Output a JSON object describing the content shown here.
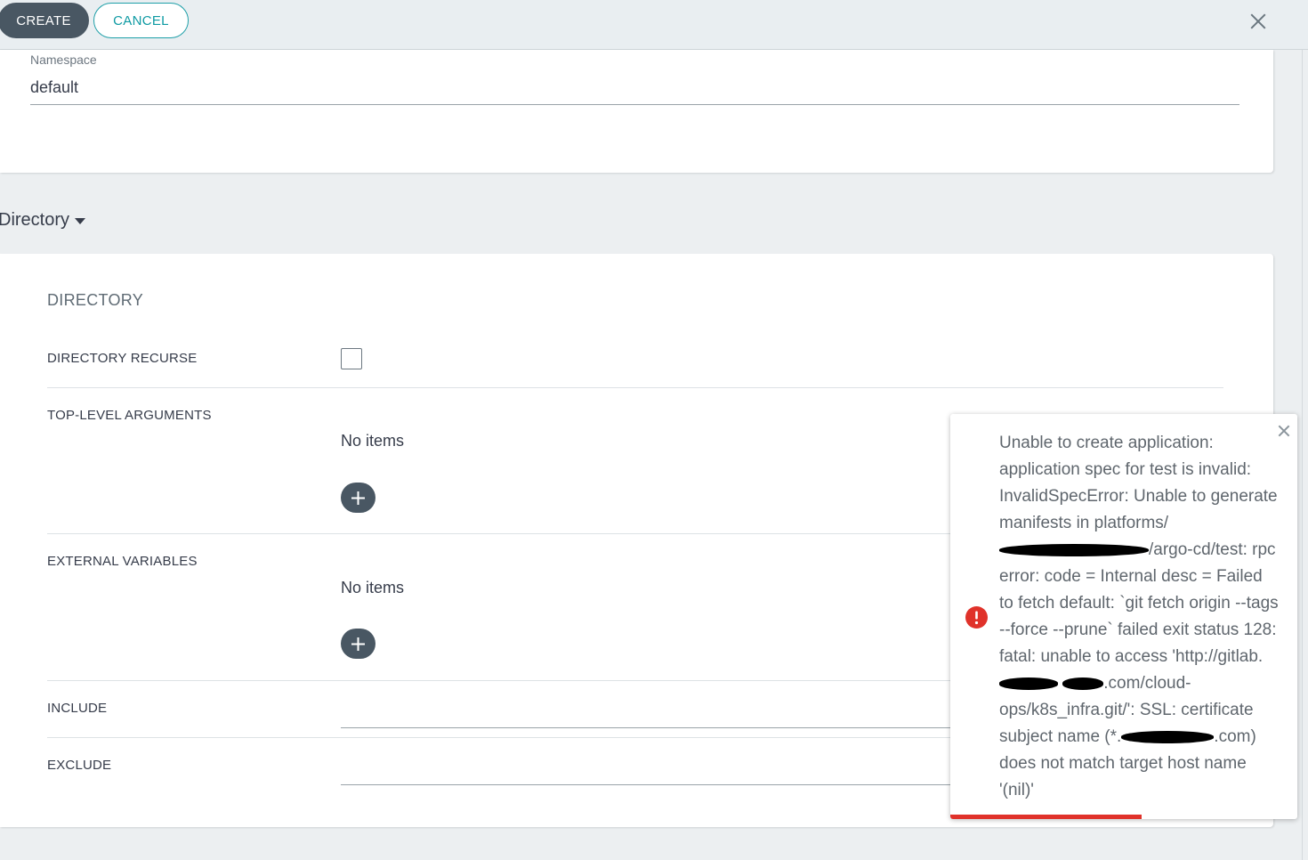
{
  "toolbar": {
    "create_label": "CREATE",
    "cancel_label": "CANCEL"
  },
  "namespace": {
    "label": "Namespace",
    "value": "default"
  },
  "section_toggle": {
    "label": "Directory"
  },
  "directory": {
    "title": "DIRECTORY",
    "recurse_label": "DIRECTORY RECURSE",
    "recurse_checked": false,
    "top_level_args": {
      "label": "TOP-LEVEL ARGUMENTS",
      "empty_text": "No items"
    },
    "external_vars": {
      "label": "EXTERNAL VARIABLES",
      "empty_text": "No items"
    },
    "include_label": "INCLUDE",
    "exclude_label": "EXCLUDE"
  },
  "toast": {
    "type": "error",
    "icon": "error-icon",
    "message_p1": "Unable to create application: application spec for test is invalid: InvalidSpecError: Unable to generate manifests in platforms/",
    "message_p2": "/argo-cd/test: rpc error: code = Internal desc = Failed to fetch default: `git fetch origin --tags --force --prune` failed exit status 128: fatal: unable to access 'http://gitlab.",
    "message_p3": ".com/cloud-ops/k8s_infra.git/': SSL: certificate subject name (*.",
    "message_p4": ".com) does not match target host name '(nil)'",
    "progress": 0.55
  },
  "colors": {
    "primary": "#495763",
    "accent": "#1e9fa8",
    "error": "#e0322a"
  }
}
